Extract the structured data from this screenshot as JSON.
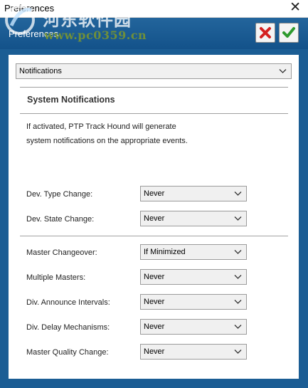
{
  "window": {
    "title": "Preferences"
  },
  "header": {
    "title": "Preferences",
    "cancel_icon": "red-x-icon",
    "ok_icon": "green-check-icon"
  },
  "watermark": {
    "cn_text": "河东软件园",
    "url": "www.pc0359.cn"
  },
  "category": {
    "selected": "Notifications"
  },
  "section": {
    "title": "System Notifications",
    "desc_line1": "If activated, PTP Track Hound will generate",
    "desc_line2": "system notifications on the appropriate events."
  },
  "settings": [
    {
      "label": "Dev. Type Change:",
      "value": "Never"
    },
    {
      "label": "Dev. State Change:",
      "value": "Never"
    },
    {
      "label": "Master Changeover:",
      "value": "If Minimized"
    },
    {
      "label": "Multiple Masters:",
      "value": "Never"
    },
    {
      "label": "Div. Announce Intervals:",
      "value": "Never"
    },
    {
      "label": "Div. Delay Mechanisms:",
      "value": "Never"
    },
    {
      "label": "Master Quality Change:",
      "value": "Never"
    }
  ],
  "colors": {
    "header_bg": "#1b5d94",
    "cancel_red": "#d42020",
    "ok_green": "#2e9a2e"
  }
}
